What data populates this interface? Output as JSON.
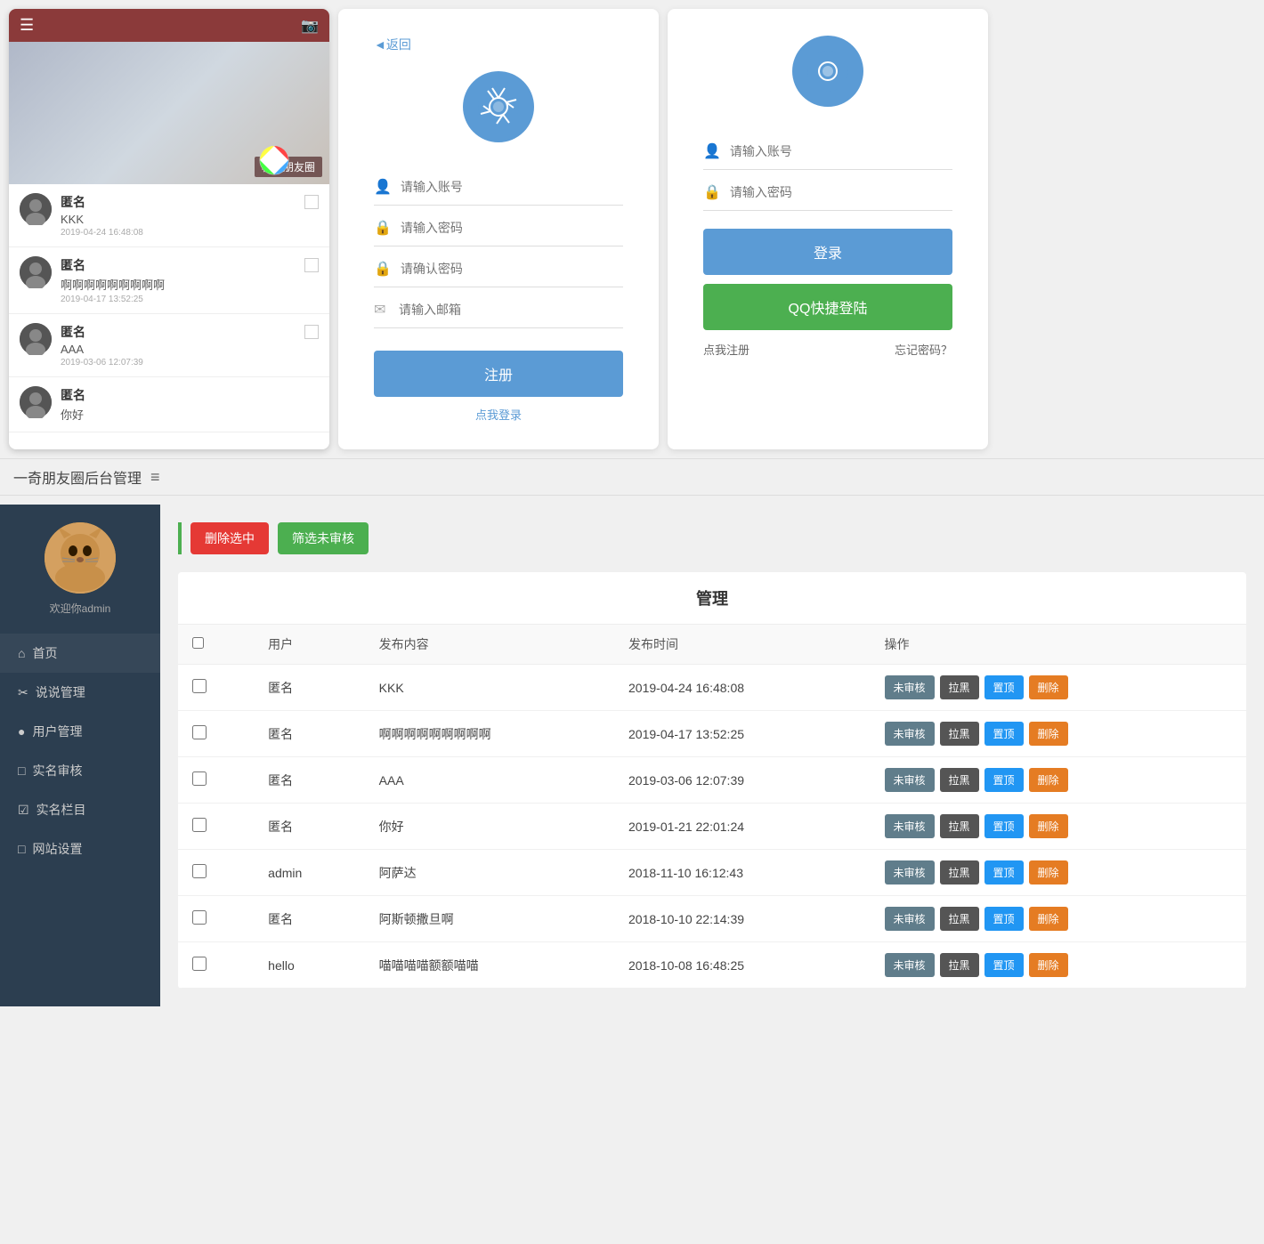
{
  "app": {
    "title": "一奇朋友圈后台管理",
    "title_icon": "≡"
  },
  "mobile": {
    "header": {
      "hamburger": "☰",
      "camera": "📷",
      "overlay_text": "校园朋友圈"
    },
    "posts": [
      {
        "name": "匿名",
        "content": "KKK",
        "time": "2019-04-24 16:48:08"
      },
      {
        "name": "匿名",
        "content": "啊啊啊啊啊啊啊啊啊",
        "time": "2019-04-17 13:52:25"
      },
      {
        "name": "匿名",
        "content": "AAA",
        "time": "2019-03-06 12:07:39"
      },
      {
        "name": "匿名",
        "content": "你好",
        "time": ""
      }
    ]
  },
  "register_form": {
    "back_text": "◄返回",
    "account_placeholder": "请输入账号",
    "password_placeholder": "请输入密码",
    "confirm_password_placeholder": "请确认密码",
    "email_placeholder": "请输入邮箱",
    "register_btn": "注册",
    "login_link": "点我登录"
  },
  "login_form": {
    "account_placeholder": "请输入账号",
    "password_placeholder": "请输入密码",
    "login_btn": "登录",
    "qq_btn": "QQ快捷登陆",
    "register_link": "点我注册",
    "forget_link": "忘记密码？"
  },
  "section_title": "一奇朋友圈后台管理",
  "sidebar": {
    "welcome": "欢迎你admin",
    "nav_items": [
      {
        "icon": "⌂",
        "label": "首页"
      },
      {
        "icon": "✂",
        "label": "说说管理"
      },
      {
        "icon": "●",
        "label": "用户管理"
      },
      {
        "icon": "□",
        "label": "实名审核"
      },
      {
        "icon": "☑",
        "label": "实名栏目"
      },
      {
        "icon": "□",
        "label": "网站设置"
      }
    ]
  },
  "admin_table": {
    "title": "管理",
    "action_bar": {
      "delete_selected": "删除选中",
      "filter_unreviewed": "筛选未审核"
    },
    "columns": [
      "",
      "用户",
      "发布内容",
      "发布时间",
      "操作"
    ],
    "action_labels": {
      "unreviewed": "未审核",
      "blacklist": "拉黑",
      "top": "置顶",
      "delete": "删除"
    },
    "rows": [
      {
        "user": "匿名",
        "content": "KKK",
        "time": "2019-04-24 16:48:08"
      },
      {
        "user": "匿名",
        "content": "啊啊啊啊啊啊啊啊啊",
        "time": "2019-04-17 13:52:25"
      },
      {
        "user": "匿名",
        "content": "AAA",
        "time": "2019-03-06 12:07:39"
      },
      {
        "user": "匿名",
        "content": "你好",
        "time": "2019-01-21 22:01:24"
      },
      {
        "user": "admin",
        "content": "阿萨达",
        "time": "2018-11-10 16:12:43"
      },
      {
        "user": "匿名",
        "content": "阿斯顿撒旦啊",
        "time": "2018-10-10 22:14:39"
      },
      {
        "user": "hello",
        "content": "喵喵喵喵额额喵喵",
        "time": "2018-10-08 16:48:25"
      }
    ]
  }
}
